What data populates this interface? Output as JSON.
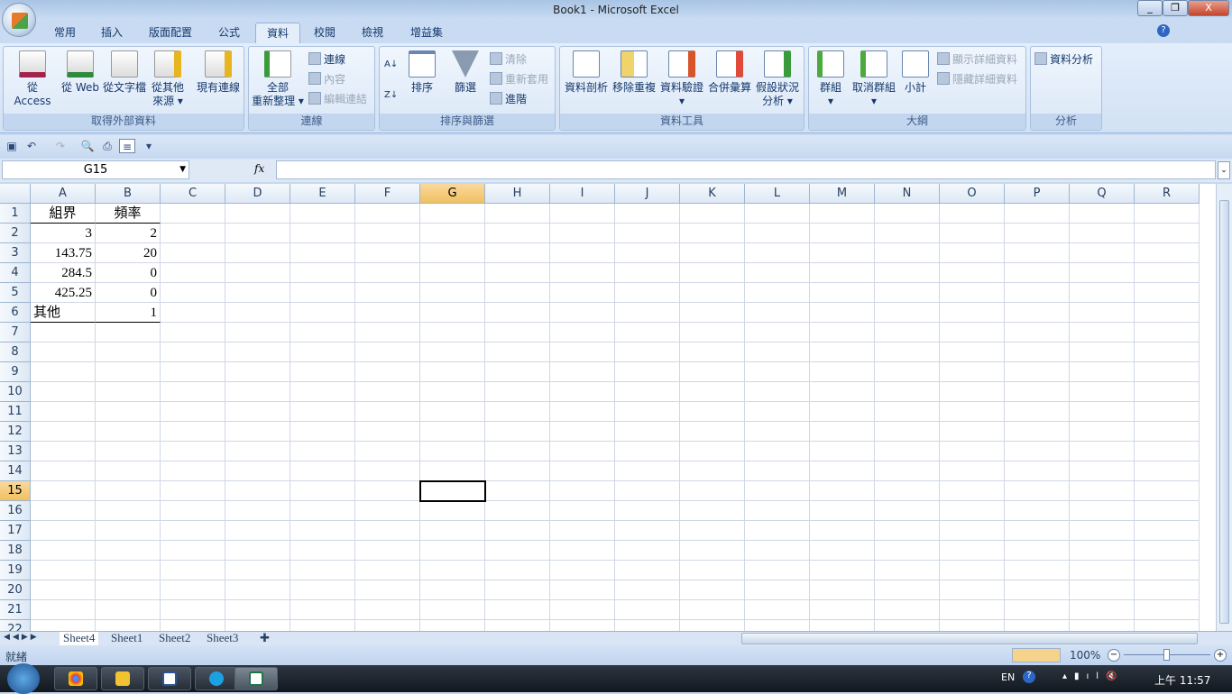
{
  "window": {
    "title": "Book1 - Microsoft Excel",
    "minimize": "_",
    "restore": "❐",
    "close": "X"
  },
  "tabs": [
    "常用",
    "插入",
    "版面配置",
    "公式",
    "資料",
    "校閱",
    "檢視",
    "增益集"
  ],
  "active_tab": "資料",
  "ribbon": {
    "groups": {
      "external": {
        "label": "取得外部資料",
        "buttons": [
          "從 Access",
          "從 Web",
          "從文字檔",
          "從其他\n來源 ▾",
          "現有連線"
        ]
      },
      "connections": {
        "label": "連線",
        "refresh": "全部",
        "refresh2": "重新整理 ▾",
        "connections": "連線",
        "properties": "內容",
        "edit_links": "編輯連結"
      },
      "sort_filter": {
        "label": "排序與篩選",
        "sort": "排序",
        "filter": "篩選",
        "clear": "清除",
        "reapply": "重新套用",
        "advanced": "進階"
      },
      "data_tools": {
        "label": "資料工具",
        "buttons": [
          "資料剖析",
          "移除重複",
          "資料驗證",
          "合併彙算",
          "假設狀況"
        ],
        "whatif2": "分析 ▾"
      },
      "outline": {
        "label": "大綱",
        "group": "群組",
        "ungroup": "取消群組",
        "subtotal": "小計",
        "show_detail": "顯示詳細資料",
        "hide_detail": "隱藏詳細資料"
      },
      "analysis": {
        "label": "分析",
        "data_analysis": "資料分析"
      }
    }
  },
  "formula_bar": {
    "name_box": "G15",
    "fx": "fx",
    "value": ""
  },
  "columns": [
    "A",
    "B",
    "C",
    "D",
    "E",
    "F",
    "G",
    "H",
    "I",
    "J",
    "K",
    "L",
    "M",
    "N",
    "O",
    "P",
    "Q",
    "R"
  ],
  "rows": [
    "1",
    "2",
    "3",
    "4",
    "5",
    "6",
    "7",
    "8",
    "9",
    "10",
    "11",
    "12",
    "13",
    "14",
    "15",
    "16",
    "17",
    "18",
    "19",
    "20",
    "21",
    "22"
  ],
  "selected_cell": "G15",
  "cells": [
    {
      "ref": "A1",
      "value": "組界",
      "align": "center"
    },
    {
      "ref": "B1",
      "value": "頻率",
      "align": "center"
    },
    {
      "ref": "A2",
      "value": "3",
      "align": "right"
    },
    {
      "ref": "B2",
      "value": "2",
      "align": "right"
    },
    {
      "ref": "A3",
      "value": "143.75",
      "align": "right"
    },
    {
      "ref": "B3",
      "value": "20",
      "align": "right"
    },
    {
      "ref": "A4",
      "value": "284.5",
      "align": "right"
    },
    {
      "ref": "B4",
      "value": "0",
      "align": "right"
    },
    {
      "ref": "A5",
      "value": "425.25",
      "align": "right"
    },
    {
      "ref": "B5",
      "value": "0",
      "align": "right"
    },
    {
      "ref": "A6",
      "value": "其他",
      "align": "left"
    },
    {
      "ref": "B6",
      "value": "1",
      "align": "right"
    }
  ],
  "sheets": [
    "Sheet4",
    "Sheet1",
    "Sheet2",
    "Sheet3"
  ],
  "active_sheet": "Sheet4",
  "status": {
    "mode": "就緒",
    "zoom": "100%"
  },
  "tray": {
    "lang": "EN",
    "time": "上午 11:57"
  }
}
